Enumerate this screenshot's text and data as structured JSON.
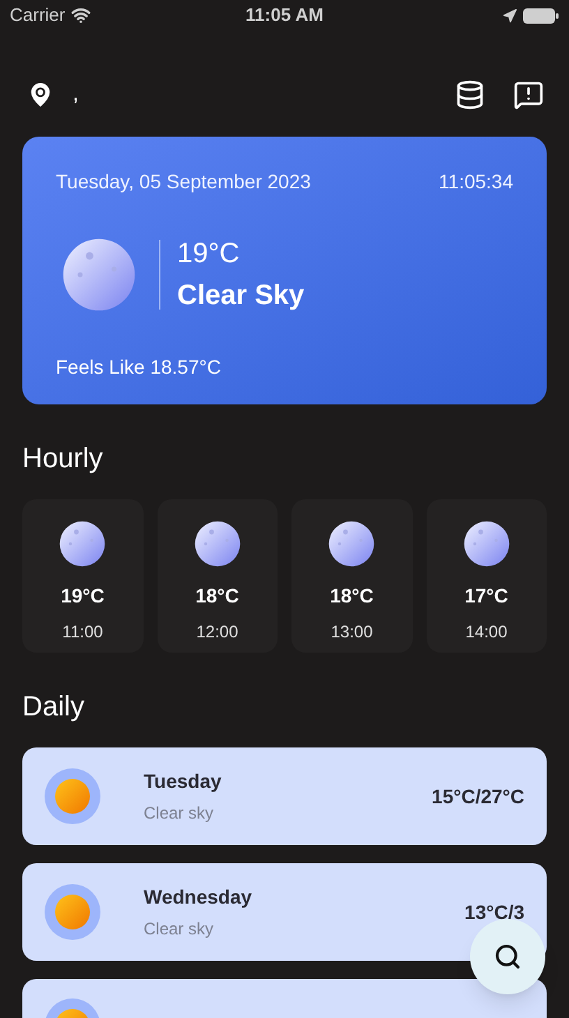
{
  "status_bar": {
    "carrier": "Carrier",
    "time": "11:05 AM"
  },
  "location": {
    "label": ","
  },
  "current": {
    "date": "Tuesday, 05 September 2023",
    "time": "11:05:34",
    "temperature": "19°C",
    "condition": "Clear Sky",
    "feels_like": "Feels Like 18.57°C"
  },
  "hourly": {
    "title": "Hourly",
    "items": [
      {
        "temperature": "19°C",
        "time": "11:00"
      },
      {
        "temperature": "18°C",
        "time": "12:00"
      },
      {
        "temperature": "18°C",
        "time": "13:00"
      },
      {
        "temperature": "17°C",
        "time": "14:00"
      }
    ]
  },
  "daily": {
    "title": "Daily",
    "items": [
      {
        "day": "Tuesday",
        "condition": "Clear sky",
        "range": "15°C/27°C"
      },
      {
        "day": "Wednesday",
        "condition": "Clear sky",
        "range": "13°C/3"
      },
      {
        "kind": "partial"
      }
    ]
  }
}
